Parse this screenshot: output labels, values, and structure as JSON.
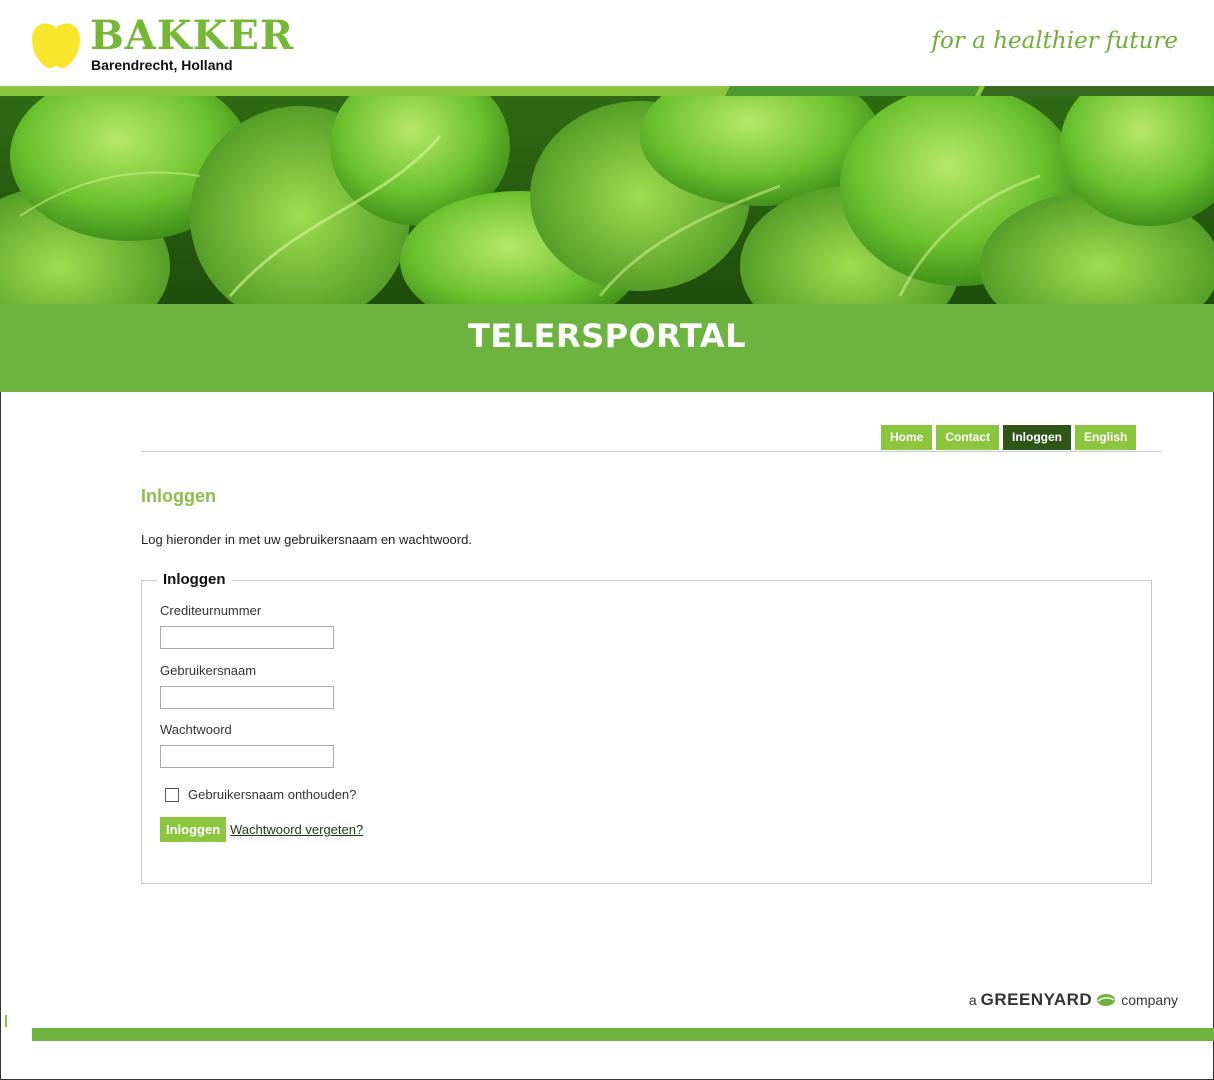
{
  "brand": {
    "name": "BAKKER",
    "location": "Barendrecht, Holland",
    "tagline": "for a healthier future",
    "accent_color": "#6db33f",
    "logo_color": "#76b735",
    "apple_color": "#f7e62b"
  },
  "banner": {
    "title": "TELERSPORTAL"
  },
  "nav": {
    "items": [
      "Home",
      "Contact",
      "Inloggen",
      "English"
    ],
    "active": "Inloggen"
  },
  "page": {
    "title": "Inloggen",
    "intro": "Log hieronder in met uw gebruikersnaam en wachtwoord."
  },
  "login_form": {
    "legend": "Inloggen",
    "fields": [
      {
        "label": "Crediteurnummer",
        "value": ""
      },
      {
        "label": "Gebruikersnaam",
        "value": ""
      },
      {
        "label": "Wachtwoord",
        "value": ""
      }
    ],
    "remember_label": "Gebruikersnaam onthouden?",
    "remember_checked": false,
    "submit_label": "Inloggen",
    "forgot_label": "Wachtwoord vergeten?"
  },
  "footer": {
    "prefix": "a",
    "brand": "GREENYARD",
    "suffix": "company"
  }
}
